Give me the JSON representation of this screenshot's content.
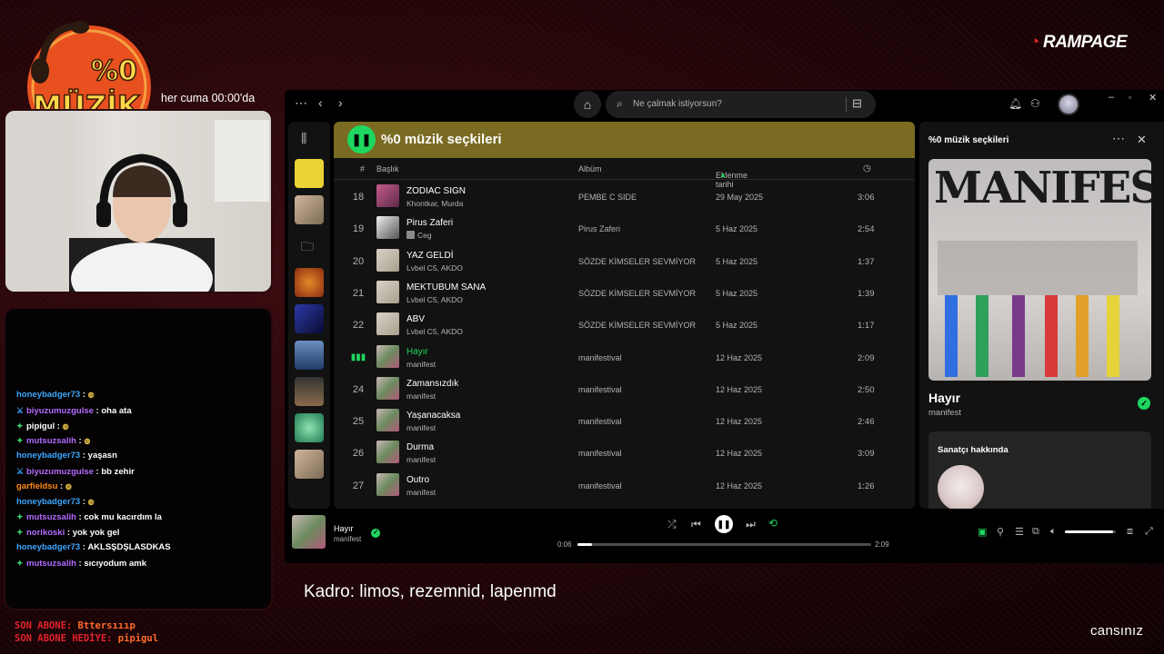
{
  "overlay": {
    "logo_line1": "%0",
    "logo_line2": "MÜZİK",
    "schedule": "her cuma 00:00'da",
    "brand": "RAMPAGE",
    "streamer": "cansınız",
    "caption": "Kadro: limos, rezemnid, lapenmd",
    "last_sub_label": "SON ABONE:",
    "last_sub_name": "Bttersıııp",
    "last_gift_label": "SON ABONE HEDİYE:",
    "last_gift_name": "pipigul"
  },
  "chat": [
    {
      "user": "honeybadger73",
      "color": "#3aa7ff",
      "badge": "",
      "msg": ""
    },
    {
      "user": "biyuzumuzgulse",
      "color": "#b06bff",
      "badge": "sword",
      "msg": "oha ata"
    },
    {
      "user": "pipigul",
      "color": "#ffffff",
      "badge": "gem",
      "msg": ""
    },
    {
      "user": "mutsuzsalih",
      "color": "#b06bff",
      "badge": "gem",
      "msg": ""
    },
    {
      "user": "honeybadger73",
      "color": "#3aa7ff",
      "badge": "",
      "msg": "yaşasn"
    },
    {
      "user": "biyuzumuzgulse",
      "color": "#b06bff",
      "badge": "sword",
      "msg": "bb zehir"
    },
    {
      "user": "garfieldsu",
      "color": "#ff8c1a",
      "badge": "",
      "msg": ""
    },
    {
      "user": "honeybadger73",
      "color": "#3aa7ff",
      "badge": "",
      "msg": ""
    },
    {
      "user": "mutsuzsalih",
      "color": "#b06bff",
      "badge": "gem",
      "msg": "cok mu kacırdım la"
    },
    {
      "user": "norikoski",
      "color": "#b06bff",
      "badge": "gem",
      "msg": "yok yok gel"
    },
    {
      "user": "honeybadger73",
      "color": "#3aa7ff",
      "badge": "",
      "msg": "AKLSŞDŞLASDKAS"
    },
    {
      "user": "mutsuzsalih",
      "color": "#b06bff",
      "badge": "gem",
      "msg": "sıcıyodum amk"
    }
  ],
  "spotify": {
    "search_placeholder": "Ne çalmak istiyorsun?",
    "playlist_title": "%0 müzik seçkileri",
    "columns": {
      "num": "#",
      "title": "Başlık",
      "album": "Albüm",
      "date": "Eklenme tarihi",
      "duration_icon": "clock-icon"
    },
    "tracks": [
      {
        "num": "18",
        "title": "ZODIAC SIGN",
        "artist": "Khontkar, Murda",
        "album": "PEMBE C SIDE",
        "date": "29 May 2025",
        "dur": "3:06",
        "thumb": "t-pink",
        "explicit": false
      },
      {
        "num": "19",
        "title": "Pirus Zaferi",
        "artist": "Ceg",
        "album": "Pirus Zaferi",
        "date": "5 Haz 2025",
        "dur": "2:54",
        "thumb": "t-bw",
        "explicit": true
      },
      {
        "num": "20",
        "title": "YAZ GELDİ",
        "artist": "Lvbel C5, AKDO",
        "album": "SÖZDE KİMSELER SEVMİYOR",
        "date": "5 Haz 2025",
        "dur": "1:37",
        "thumb": "t-paper",
        "explicit": false
      },
      {
        "num": "21",
        "title": "MEKTUBUM SANA",
        "artist": "Lvbel C5, AKDO",
        "album": "SÖZDE KİMSELER SEVMİYOR",
        "date": "5 Haz 2025",
        "dur": "1:39",
        "thumb": "t-paper",
        "explicit": false
      },
      {
        "num": "22",
        "title": "ABV",
        "artist": "Lvbel C5, AKDO",
        "album": "SÖZDE KİMSELER SEVMİYOR",
        "date": "5 Haz 2025",
        "dur": "1:17",
        "thumb": "t-paper",
        "explicit": false
      },
      {
        "num": "",
        "title": "Hayır",
        "artist": "manifest",
        "album": "manifestival",
        "date": "12 Haz 2025",
        "dur": "2:09",
        "thumb": "t-mani",
        "explicit": false,
        "active": true
      },
      {
        "num": "24",
        "title": "Zamansızdık",
        "artist": "manifest",
        "album": "manifestival",
        "date": "12 Haz 2025",
        "dur": "2:50",
        "thumb": "t-mani",
        "explicit": false
      },
      {
        "num": "25",
        "title": "Yaşanacaksa",
        "artist": "manifest",
        "album": "manifestival",
        "date": "12 Haz 2025",
        "dur": "2:46",
        "thumb": "t-mani",
        "explicit": false
      },
      {
        "num": "26",
        "title": "Durma",
        "artist": "manifest",
        "album": "manifestival",
        "date": "12 Haz 2025",
        "dur": "3:09",
        "thumb": "t-mani",
        "explicit": false
      },
      {
        "num": "27",
        "title": "Outro",
        "artist": "manifest",
        "album": "manifestival",
        "date": "12 Haz 2025",
        "dur": "1:26",
        "thumb": "t-mani",
        "explicit": false
      }
    ],
    "right_panel": {
      "title": "%0 müzik seçkileri",
      "cover_word": "MANIFEST",
      "song": "Hayır",
      "artist": "manifest",
      "about_title": "Sanatçı hakkında"
    },
    "now_playing": {
      "title": "Hayır",
      "artist": "manifest",
      "elapsed": "0:06",
      "total": "2:09",
      "progress": 0.05,
      "volume": 0.95
    },
    "sidebar_thumbs": [
      "t-yellow",
      "t-photo",
      "folder",
      "t-orange",
      "t-blue",
      "t-nkvt",
      "t-friday",
      "t-green",
      "t-photo",
      "t-dark"
    ]
  }
}
